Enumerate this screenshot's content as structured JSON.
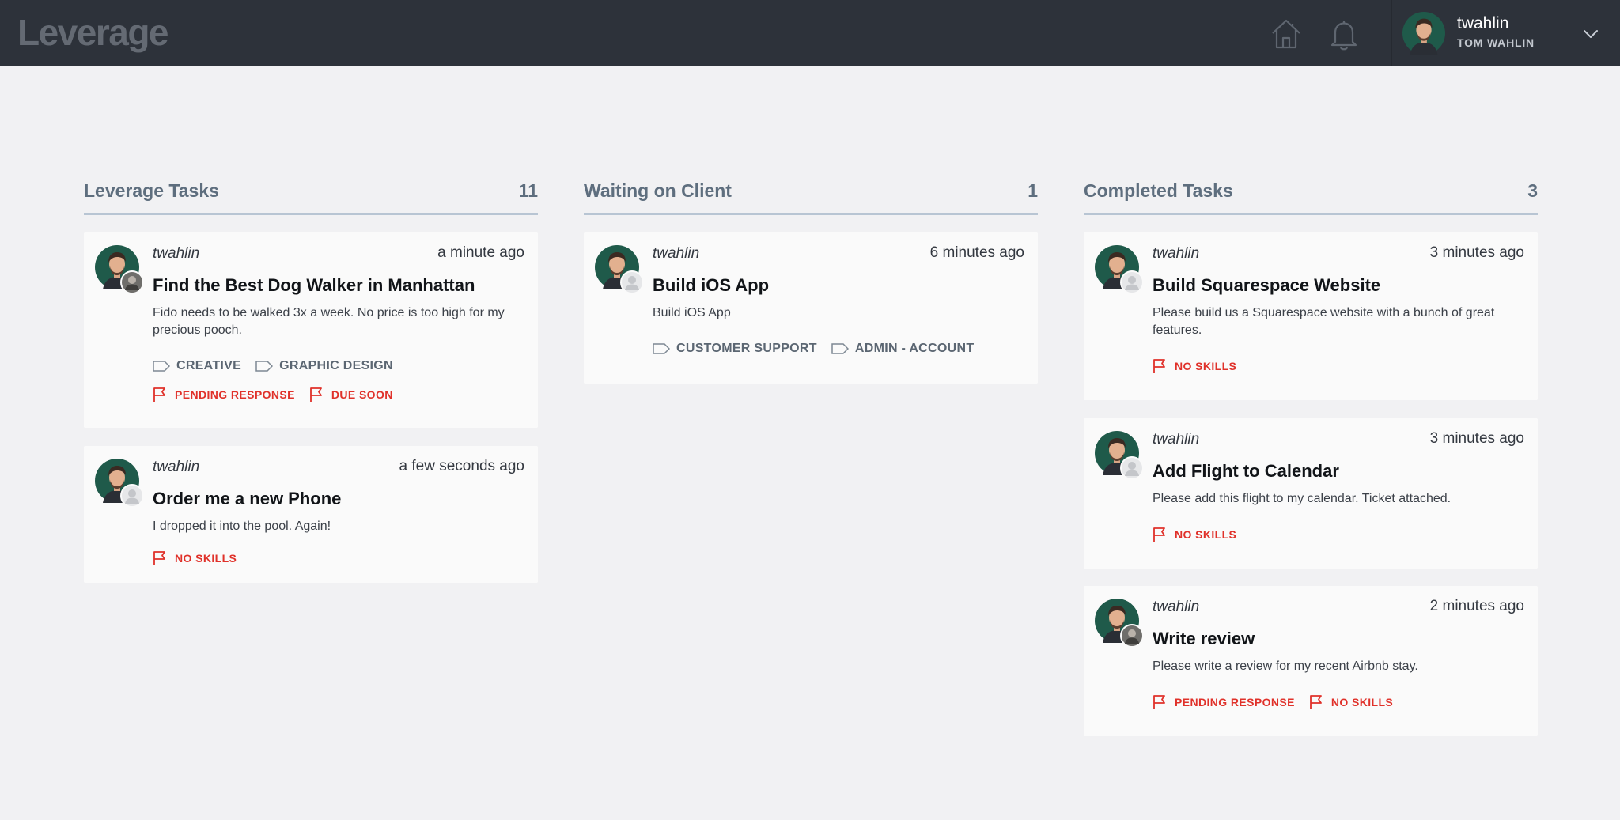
{
  "app": {
    "logo": "Leverage"
  },
  "header": {
    "user": {
      "username": "twahlin",
      "full_name": "TOM WAHLIN"
    }
  },
  "columns": [
    {
      "title": "Leverage Tasks",
      "count": "11",
      "cards": [
        {
          "user": "twahlin",
          "time": "a minute ago",
          "title": "Find the Best Dog Walker in Manhattan",
          "description": "Fido needs to be walked 3x a week. No price is too high for my precious pooch.",
          "tags": [
            "CREATIVE",
            "GRAPHIC DESIGN"
          ],
          "flags": [
            "PENDING RESPONSE",
            "DUE SOON"
          ]
        },
        {
          "user": "twahlin",
          "time": "a few seconds ago",
          "title": "Order me a new Phone",
          "description": "I dropped it into the pool. Again!",
          "tags": [],
          "flags": [
            "NO SKILLS"
          ]
        }
      ]
    },
    {
      "title": "Waiting on Client",
      "count": "1",
      "cards": [
        {
          "user": "twahlin",
          "time": "6 minutes ago",
          "title": "Build iOS App",
          "description": "Build iOS App",
          "tags": [
            "CUSTOMER SUPPORT",
            "ADMIN - ACCOUNT"
          ],
          "flags": []
        }
      ]
    },
    {
      "title": "Completed Tasks",
      "count": "3",
      "cards": [
        {
          "user": "twahlin",
          "time": "3 minutes ago",
          "title": "Build Squarespace Website",
          "description": "Please build us a Squarespace website with a bunch of great features.",
          "tags": [],
          "flags": [
            "NO SKILLS"
          ]
        },
        {
          "user": "twahlin",
          "time": "3 minutes ago",
          "title": "Add Flight to Calendar",
          "description": "Please add this flight to my calendar. Ticket attached.",
          "tags": [],
          "flags": [
            "NO SKILLS"
          ]
        },
        {
          "user": "twahlin",
          "time": "2 minutes ago",
          "title": "Write review",
          "description": "Please write a review for my recent Airbnb stay.",
          "tags": [],
          "flags": [
            "PENDING RESPONSE",
            "NO SKILLS"
          ]
        }
      ]
    }
  ],
  "colors": {
    "topbar": "#2d323a",
    "background": "#f1f1f3",
    "flag_red": "#e0312a",
    "column_rule": "#b8c5d3"
  },
  "icons": {
    "nav": [
      "home-icon",
      "bell-icon",
      "chevron-down-icon"
    ],
    "tag": "tag-icon",
    "flag": "flag-icon"
  }
}
